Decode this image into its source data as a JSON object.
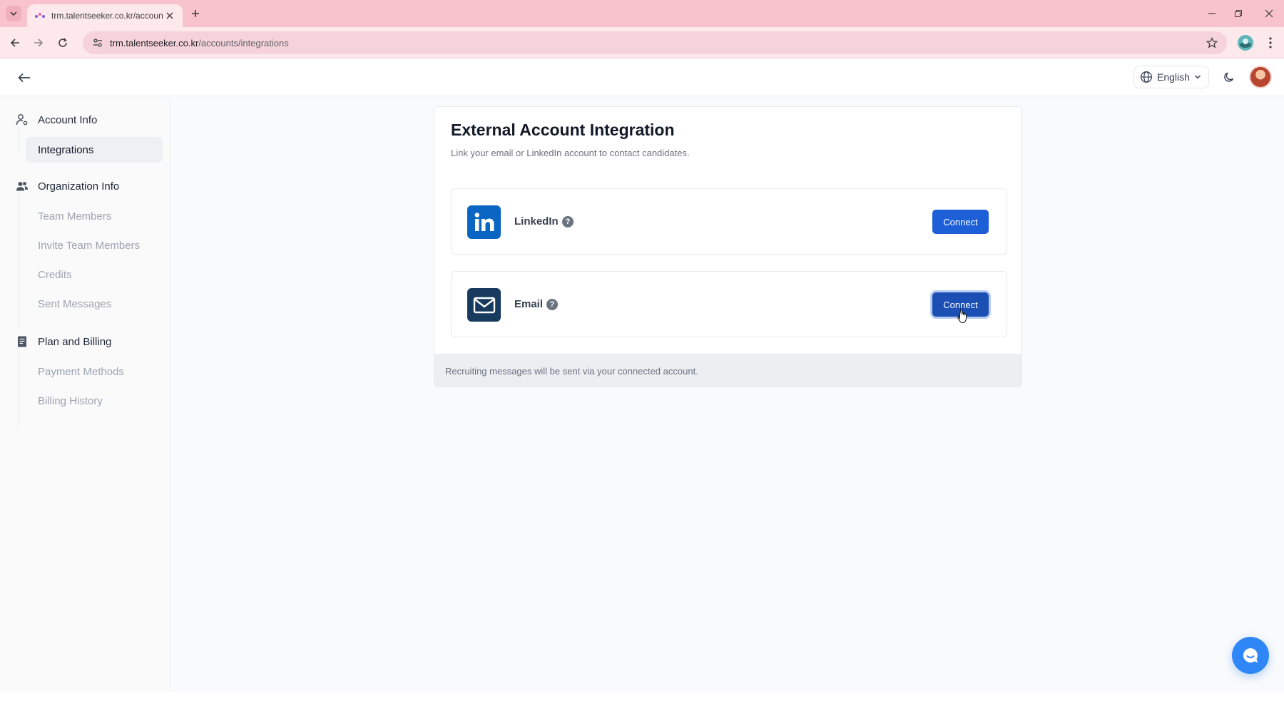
{
  "browser": {
    "tab_title": "trm.talentseeker.co.kr/accounts",
    "url_host": "trm.talentseeker.co.kr",
    "url_path": "/accounts/integrations"
  },
  "header": {
    "language": "English"
  },
  "sidebar": {
    "sections": [
      {
        "label": "Account Info",
        "icon": "user-cog-icon",
        "items": [
          {
            "label": "Integrations",
            "active": true
          }
        ]
      },
      {
        "label": "Organization Info",
        "icon": "users-icon",
        "items": [
          {
            "label": "Team Members"
          },
          {
            "label": "Invite Team Members"
          },
          {
            "label": "Credits"
          },
          {
            "label": "Sent Messages"
          }
        ]
      },
      {
        "label": "Plan and Billing",
        "icon": "receipt-icon",
        "items": [
          {
            "label": "Payment Methods"
          },
          {
            "label": "Billing History"
          }
        ]
      }
    ]
  },
  "card": {
    "title": "External Account Integration",
    "subtitle": "Link your email or LinkedIn account to contact candidates.",
    "integrations": [
      {
        "name": "LinkedIn",
        "icon": "linkedin-icon",
        "button": "Connect"
      },
      {
        "name": "Email",
        "icon": "mail-icon",
        "button": "Connect"
      }
    ],
    "footer_note": "Recruiting messages will be sent via your connected account."
  },
  "colors": {
    "tab_bar": "#f9c3cd",
    "primary_button": "#1d5fd6",
    "linkedin_blue": "#0a66c2",
    "email_navy": "#173a5e",
    "chat_button": "#2f86f6"
  }
}
